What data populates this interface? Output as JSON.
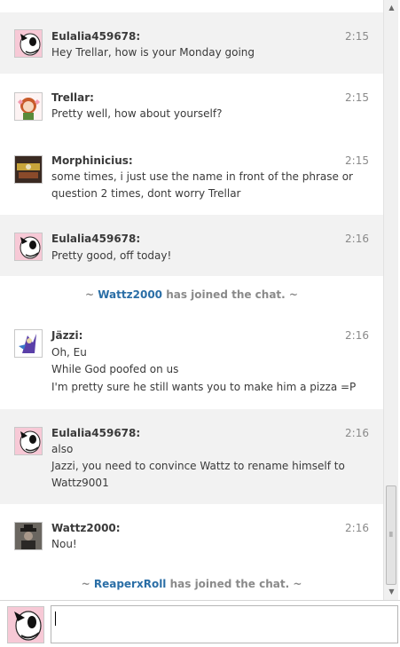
{
  "messages": [
    {
      "user": "Eulalia459678:",
      "time": "2:15",
      "lines": [
        "Hey Trellar, how is your Monday going"
      ],
      "avatar": "spike-cartoon-avatar",
      "shaded": true
    },
    {
      "user": "Trellar:",
      "time": "2:15",
      "lines": [
        "Pretty well, how about yourself?"
      ],
      "avatar": "redhead-girl-avatar",
      "shaded": false
    },
    {
      "user": "Morphinicius:",
      "time": "2:15",
      "lines": [
        "some times, i just use the name in front of the phrase or",
        "question 2 times, dont worry Trellar"
      ],
      "avatar": "game-logo-avatar",
      "shaded": false
    },
    {
      "user": "Eulalia459678:",
      "time": "2:16",
      "lines": [
        "Pretty good, off today!"
      ],
      "avatar": "spike-cartoon-avatar",
      "shaded": true
    },
    {
      "user": "Jäzzi:",
      "time": "2:16",
      "lines": [
        "Oh, Eu",
        "While God poofed on us",
        "I'm pretty sure he still wants you to make him a pizza =P"
      ],
      "avatar": "purple-character-avatar",
      "shaded": false
    },
    {
      "user": "Eulalia459678:",
      "time": "2:16",
      "lines": [
        "also",
        "Jazzi, you need to convince Wattz to rename himself to",
        "Wattz9001"
      ],
      "avatar": "spike-cartoon-avatar",
      "shaded": true
    },
    {
      "user": "Wattz2000:",
      "time": "2:16",
      "lines": [
        "Nou!"
      ],
      "avatar": "hat-figure-avatar",
      "shaded": false
    }
  ],
  "joins": [
    {
      "prefix": "~",
      "name": "Wattz2000",
      "text": "has joined the chat.",
      "suffix": "~"
    },
    {
      "prefix": "~",
      "name": "ReaperxRoll",
      "text": "has joined the chat.",
      "suffix": "~"
    }
  ],
  "input": {
    "value": "",
    "placeholder": ""
  },
  "icons": {
    "scroll_up": "scroll-up-arrow-icon",
    "scroll_down": "scroll-down-arrow-icon"
  },
  "colors": {
    "join_name": "#2a6ea6",
    "shaded_row": "#f2f2f2",
    "timestamp": "#8a8a8a"
  }
}
